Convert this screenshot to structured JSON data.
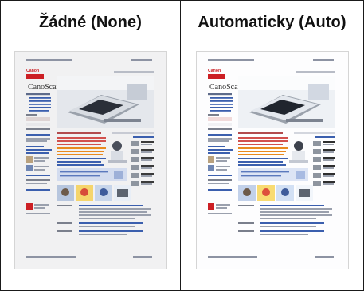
{
  "columns": [
    {
      "label": "Žádné (None)"
    },
    {
      "label": "Automaticky (Auto)"
    }
  ],
  "scanned_page": {
    "brand": "Canon",
    "headline": "CanoScan"
  },
  "colors": {
    "brand_red": "#cc1f24",
    "link_blue": "#3b5fae",
    "accent_orange": "#e98a1f",
    "none_page_bg": "#f1f1f2",
    "auto_page_bg": "#fdfdfe"
  }
}
